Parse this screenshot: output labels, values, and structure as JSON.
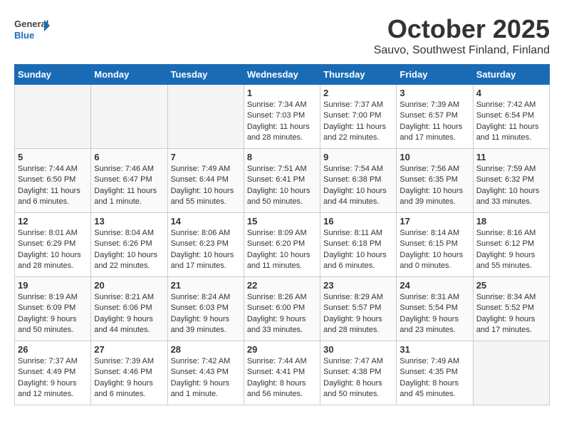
{
  "header": {
    "logo_general": "General",
    "logo_blue": "Blue",
    "month_title": "October 2025",
    "location": "Sauvo, Southwest Finland, Finland"
  },
  "weekdays": [
    "Sunday",
    "Monday",
    "Tuesday",
    "Wednesday",
    "Thursday",
    "Friday",
    "Saturday"
  ],
  "weeks": [
    [
      {
        "day": "",
        "info": ""
      },
      {
        "day": "",
        "info": ""
      },
      {
        "day": "",
        "info": ""
      },
      {
        "day": "1",
        "info": "Sunrise: 7:34 AM\nSunset: 7:03 PM\nDaylight: 11 hours and 28 minutes."
      },
      {
        "day": "2",
        "info": "Sunrise: 7:37 AM\nSunset: 7:00 PM\nDaylight: 11 hours and 22 minutes."
      },
      {
        "day": "3",
        "info": "Sunrise: 7:39 AM\nSunset: 6:57 PM\nDaylight: 11 hours and 17 minutes."
      },
      {
        "day": "4",
        "info": "Sunrise: 7:42 AM\nSunset: 6:54 PM\nDaylight: 11 hours and 11 minutes."
      }
    ],
    [
      {
        "day": "5",
        "info": "Sunrise: 7:44 AM\nSunset: 6:50 PM\nDaylight: 11 hours and 6 minutes."
      },
      {
        "day": "6",
        "info": "Sunrise: 7:46 AM\nSunset: 6:47 PM\nDaylight: 11 hours and 1 minute."
      },
      {
        "day": "7",
        "info": "Sunrise: 7:49 AM\nSunset: 6:44 PM\nDaylight: 10 hours and 55 minutes."
      },
      {
        "day": "8",
        "info": "Sunrise: 7:51 AM\nSunset: 6:41 PM\nDaylight: 10 hours and 50 minutes."
      },
      {
        "day": "9",
        "info": "Sunrise: 7:54 AM\nSunset: 6:38 PM\nDaylight: 10 hours and 44 minutes."
      },
      {
        "day": "10",
        "info": "Sunrise: 7:56 AM\nSunset: 6:35 PM\nDaylight: 10 hours and 39 minutes."
      },
      {
        "day": "11",
        "info": "Sunrise: 7:59 AM\nSunset: 6:32 PM\nDaylight: 10 hours and 33 minutes."
      }
    ],
    [
      {
        "day": "12",
        "info": "Sunrise: 8:01 AM\nSunset: 6:29 PM\nDaylight: 10 hours and 28 minutes."
      },
      {
        "day": "13",
        "info": "Sunrise: 8:04 AM\nSunset: 6:26 PM\nDaylight: 10 hours and 22 minutes."
      },
      {
        "day": "14",
        "info": "Sunrise: 8:06 AM\nSunset: 6:23 PM\nDaylight: 10 hours and 17 minutes."
      },
      {
        "day": "15",
        "info": "Sunrise: 8:09 AM\nSunset: 6:20 PM\nDaylight: 10 hours and 11 minutes."
      },
      {
        "day": "16",
        "info": "Sunrise: 8:11 AM\nSunset: 6:18 PM\nDaylight: 10 hours and 6 minutes."
      },
      {
        "day": "17",
        "info": "Sunrise: 8:14 AM\nSunset: 6:15 PM\nDaylight: 10 hours and 0 minutes."
      },
      {
        "day": "18",
        "info": "Sunrise: 8:16 AM\nSunset: 6:12 PM\nDaylight: 9 hours and 55 minutes."
      }
    ],
    [
      {
        "day": "19",
        "info": "Sunrise: 8:19 AM\nSunset: 6:09 PM\nDaylight: 9 hours and 50 minutes."
      },
      {
        "day": "20",
        "info": "Sunrise: 8:21 AM\nSunset: 6:06 PM\nDaylight: 9 hours and 44 minutes."
      },
      {
        "day": "21",
        "info": "Sunrise: 8:24 AM\nSunset: 6:03 PM\nDaylight: 9 hours and 39 minutes."
      },
      {
        "day": "22",
        "info": "Sunrise: 8:26 AM\nSunset: 6:00 PM\nDaylight: 9 hours and 33 minutes."
      },
      {
        "day": "23",
        "info": "Sunrise: 8:29 AM\nSunset: 5:57 PM\nDaylight: 9 hours and 28 minutes."
      },
      {
        "day": "24",
        "info": "Sunrise: 8:31 AM\nSunset: 5:54 PM\nDaylight: 9 hours and 23 minutes."
      },
      {
        "day": "25",
        "info": "Sunrise: 8:34 AM\nSunset: 5:52 PM\nDaylight: 9 hours and 17 minutes."
      }
    ],
    [
      {
        "day": "26",
        "info": "Sunrise: 7:37 AM\nSunset: 4:49 PM\nDaylight: 9 hours and 12 minutes."
      },
      {
        "day": "27",
        "info": "Sunrise: 7:39 AM\nSunset: 4:46 PM\nDaylight: 9 hours and 6 minutes."
      },
      {
        "day": "28",
        "info": "Sunrise: 7:42 AM\nSunset: 4:43 PM\nDaylight: 9 hours and 1 minute."
      },
      {
        "day": "29",
        "info": "Sunrise: 7:44 AM\nSunset: 4:41 PM\nDaylight: 8 hours and 56 minutes."
      },
      {
        "day": "30",
        "info": "Sunrise: 7:47 AM\nSunset: 4:38 PM\nDaylight: 8 hours and 50 minutes."
      },
      {
        "day": "31",
        "info": "Sunrise: 7:49 AM\nSunset: 4:35 PM\nDaylight: 8 hours and 45 minutes."
      },
      {
        "day": "",
        "info": ""
      }
    ]
  ]
}
